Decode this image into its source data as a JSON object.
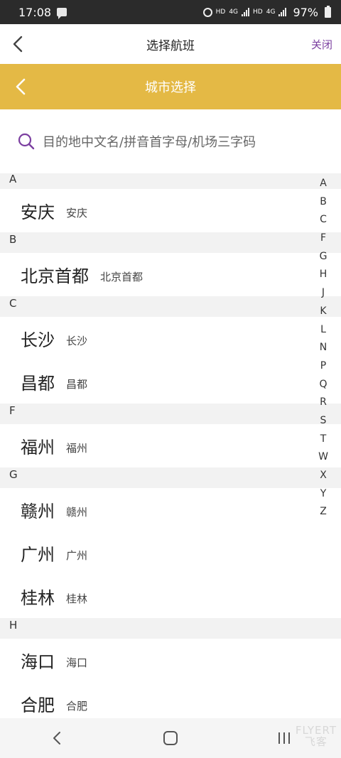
{
  "status_bar": {
    "time": "17:08",
    "hd1": "HD",
    "net1": "4G",
    "hd2": "HD",
    "net2": "4G",
    "battery": "97%"
  },
  "top_nav": {
    "title": "选择航班",
    "close_label": "关闭"
  },
  "header": {
    "title": "城市选择",
    "color": "#e4b945"
  },
  "search": {
    "placeholder": "目的地中文名/拼音首字母/机场三字码"
  },
  "sections": [
    {
      "letter": "A",
      "cities": [
        {
          "name": "安庆",
          "sub": "安庆"
        }
      ]
    },
    {
      "letter": "B",
      "cities": [
        {
          "name": "北京首都",
          "sub": "北京首都"
        }
      ]
    },
    {
      "letter": "C",
      "cities": [
        {
          "name": "长沙",
          "sub": "长沙"
        },
        {
          "name": "昌都",
          "sub": "昌都"
        }
      ]
    },
    {
      "letter": "F",
      "cities": [
        {
          "name": "福州",
          "sub": "福州"
        }
      ]
    },
    {
      "letter": "G",
      "cities": [
        {
          "name": "赣州",
          "sub": "赣州"
        },
        {
          "name": "广州",
          "sub": "广州"
        },
        {
          "name": "桂林",
          "sub": "桂林"
        }
      ]
    },
    {
      "letter": "H",
      "cities": [
        {
          "name": "海口",
          "sub": "海口"
        },
        {
          "name": "合肥",
          "sub": "合肥"
        }
      ]
    }
  ],
  "alpha_index": [
    "A",
    "B",
    "C",
    "F",
    "G",
    "H",
    "J",
    "K",
    "L",
    "N",
    "P",
    "Q",
    "R",
    "S",
    "T",
    "W",
    "X",
    "Y",
    "Z"
  ],
  "watermark": {
    "line1": "FLYERT",
    "line2": "飞客"
  },
  "colors": {
    "accent_purple": "#7b3fa0",
    "section_bg": "#f2f2f2"
  }
}
